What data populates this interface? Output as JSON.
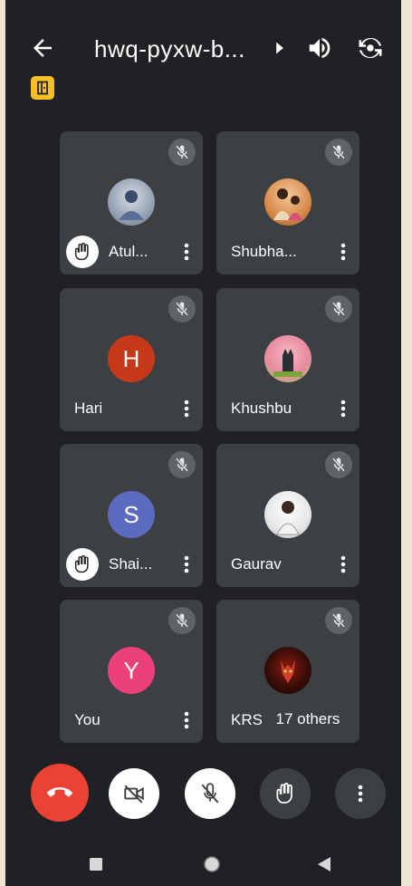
{
  "meeting": {
    "title": "hwq-pyxw-b..."
  },
  "participants": [
    {
      "name": "Atul...",
      "muted": true,
      "hand_raised": true,
      "avatar_type": "photo",
      "avatar_color": "#9aa7b8"
    },
    {
      "name": "Shubha...",
      "muted": true,
      "hand_raised": false,
      "avatar_type": "photo",
      "avatar_color": "#d98a4a"
    },
    {
      "name": "Hari",
      "muted": true,
      "hand_raised": false,
      "avatar_type": "letter",
      "avatar_letter": "H",
      "avatar_color": "#c5391a"
    },
    {
      "name": "Khushbu",
      "muted": true,
      "hand_raised": false,
      "avatar_type": "photo",
      "avatar_color": "#e88aa0"
    },
    {
      "name": "Shai...",
      "muted": true,
      "hand_raised": true,
      "avatar_type": "letter",
      "avatar_letter": "S",
      "avatar_color": "#5c6bc0"
    },
    {
      "name": "Gaurav",
      "muted": true,
      "hand_raised": false,
      "avatar_type": "photo",
      "avatar_color": "#dcdcdc"
    },
    {
      "name": "You",
      "muted": true,
      "hand_raised": false,
      "avatar_type": "letter",
      "avatar_letter": "Y",
      "avatar_color": "#ec407a"
    },
    {
      "name": "KRS",
      "muted": true,
      "hand_raised": false,
      "avatar_type": "photo",
      "avatar_color": "#2a1210"
    }
  ],
  "others_label": "17 others",
  "colors": {
    "background": "#202124",
    "tile": "#3c4043",
    "end_call": "#ea4335",
    "badge": "#f6bf26"
  },
  "icons": {
    "back": "arrow-back-icon",
    "title_chevron": "chevron-right-icon",
    "speaker": "speaker-icon",
    "switch_camera": "switch-camera-icon",
    "host_badge": "door-icon",
    "mute": "mic-off-icon",
    "hand": "raised-hand-icon",
    "more": "more-vertical-icon",
    "end_call": "call-end-icon",
    "camera_off": "videocam-off-icon",
    "mic_off": "mic-off-icon",
    "raise_hand": "raised-hand-icon",
    "options": "more-vertical-icon",
    "nav_recents": "square-icon",
    "nav_home": "circle-icon",
    "nav_back": "triangle-icon"
  }
}
